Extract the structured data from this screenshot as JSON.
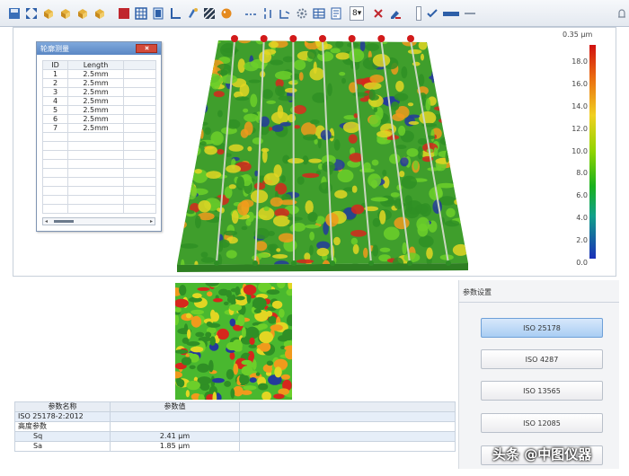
{
  "profile_window": {
    "title": "轮廓测量",
    "columns": [
      "ID",
      "Length",
      ""
    ],
    "rows": [
      {
        "id": "1",
        "length": "2.5mm"
      },
      {
        "id": "2",
        "length": "2.5mm"
      },
      {
        "id": "3",
        "length": "2.5mm"
      },
      {
        "id": "4",
        "length": "2.5mm"
      },
      {
        "id": "5",
        "length": "2.5mm"
      },
      {
        "id": "6",
        "length": "2.5mm"
      },
      {
        "id": "7",
        "length": "2.5mm"
      }
    ]
  },
  "legend": {
    "unit": "0.35 μm",
    "ticks": [
      "18.0",
      "16.0",
      "14.0",
      "12.0",
      "10.0",
      "8.0",
      "6.0",
      "4.0",
      "2.0",
      "0.0"
    ]
  },
  "params_table": {
    "headers": [
      "参数名称",
      "参数值",
      ""
    ],
    "rows": [
      {
        "name": "ISO 25178-2:2012",
        "value": ""
      },
      {
        "name": "高度参数",
        "value": ""
      },
      {
        "name": "Sq",
        "value": "2.41 μm"
      },
      {
        "name": "Sa",
        "value": "1.85 μm"
      }
    ]
  },
  "right_panel": {
    "title": "参数设置",
    "buttons": [
      "ISO 25178",
      "ISO 4287",
      "ISO 13565",
      "ISO 12085"
    ]
  },
  "toolbar": {
    "select_value": "8",
    "input_value": ""
  },
  "watermark": "头条 @中图仪器"
}
